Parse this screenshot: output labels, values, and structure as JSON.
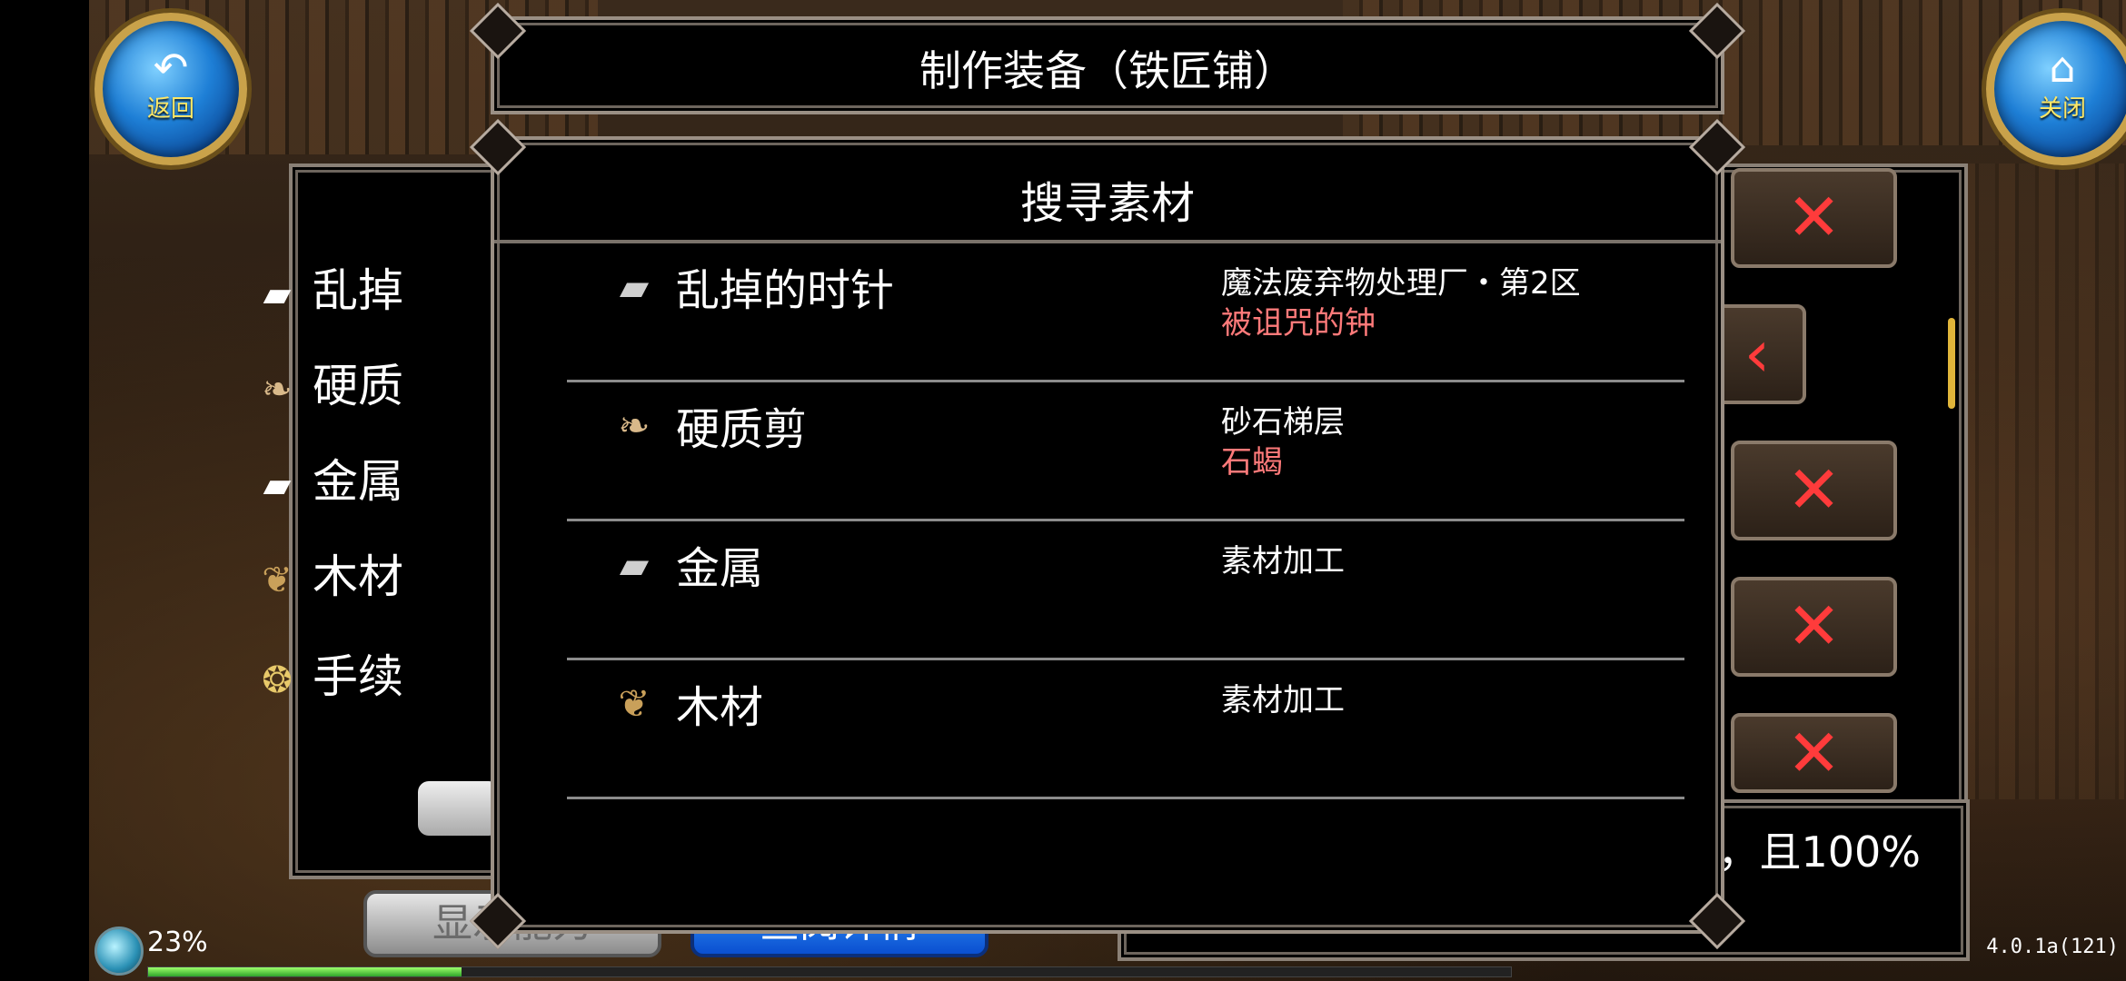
{
  "header": {
    "title": "制作装备（铁匠铺）"
  },
  "back_button": {
    "label": "返回"
  },
  "close_button": {
    "label": "关闭"
  },
  "background_list": [
    {
      "icon": "metal-ingot-icon",
      "label": "乱掉"
    },
    {
      "icon": "claw-icon",
      "label": "硬质"
    },
    {
      "icon": "metal-ingot-icon",
      "label": "金属"
    },
    {
      "icon": "wood-log-icon",
      "label": "木材"
    },
    {
      "icon": "coins-icon",
      "label": "手续"
    }
  ],
  "background_text": {
    "right_note": "，且100%",
    "show_ability": "显示能力",
    "view_details": "查阅详情"
  },
  "dialog": {
    "title": "搜寻素材",
    "rows": [
      {
        "icon": "metal-ingot-icon",
        "name": "乱掉的时针",
        "location": "魔法废弃物处理厂・第2区",
        "source": "被诅咒的钟"
      },
      {
        "icon": "claw-icon",
        "name": "硬质剪",
        "location": "砂石梯层",
        "source": "石蝎"
      },
      {
        "icon": "metal-ingot-icon",
        "name": "金属",
        "location": "素材加工",
        "source": ""
      },
      {
        "icon": "wood-log-icon",
        "name": "木材",
        "location": "素材加工",
        "source": ""
      }
    ]
  },
  "status": {
    "percent": "23%",
    "progress": 0.23
  },
  "version": "4.0.1a(121)",
  "colors": {
    "source_text": "#ff7a7a",
    "accent_gold": "#c9a24a",
    "close_x": "#ff3b3b"
  }
}
